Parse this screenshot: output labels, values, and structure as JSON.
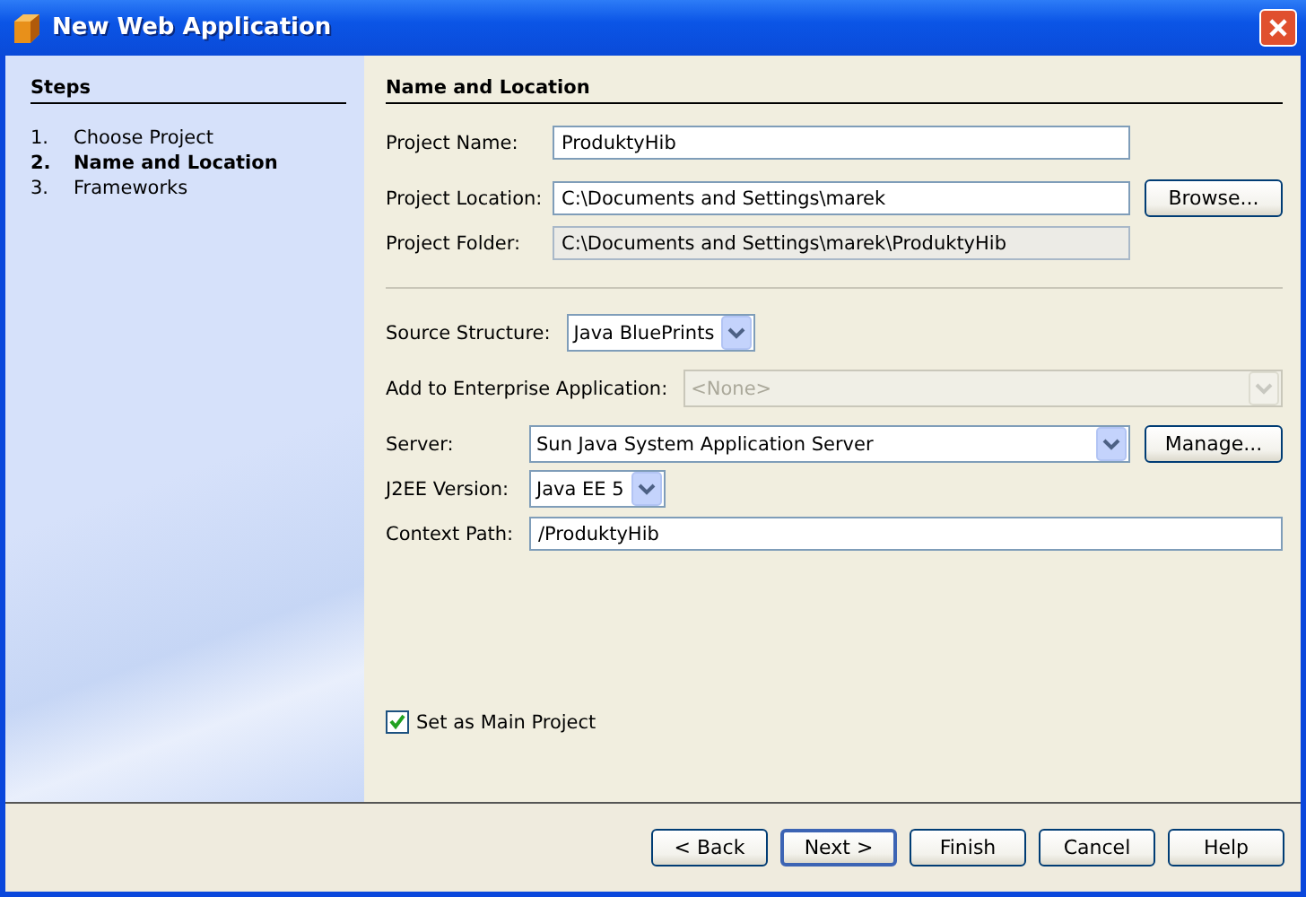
{
  "window": {
    "title": "New Web Application"
  },
  "steps": {
    "title": "Steps",
    "items": [
      {
        "number": "1.",
        "label": "Choose Project",
        "selected": false
      },
      {
        "number": "2.",
        "label": "Name and Location",
        "selected": true
      },
      {
        "number": "3.",
        "label": "Frameworks",
        "selected": false
      }
    ]
  },
  "panel": {
    "title": "Name and Location",
    "location_fields": [
      {
        "kind": "text",
        "label": "Project Name:",
        "value": "ProduktyHib"
      },
      {
        "kind": "text",
        "label": "Project Location:",
        "value": "C:\\Documents and Settings\\marek",
        "button": "Browse..."
      },
      {
        "kind": "readonly",
        "label": "Project Folder:",
        "value": "C:\\Documents and Settings\\marek\\ProduktyHib"
      }
    ],
    "settings_fields": [
      {
        "kind": "dropdown",
        "label": "Source Structure:",
        "value": "Java BluePrints",
        "disabled": false
      },
      {
        "kind": "combo",
        "label": "Add to Enterprise Application:",
        "value": "<None>",
        "disabled": true
      },
      {
        "kind": "combo",
        "label": "Server:",
        "value": "Sun Java System Application Server",
        "disabled": false,
        "button": "Manage..."
      },
      {
        "kind": "dropdown",
        "label": "J2EE Version:",
        "value": "Java EE 5",
        "disabled": false
      },
      {
        "kind": "text",
        "label": "Context Path:",
        "value": "/ProduktyHib"
      }
    ],
    "main_project": {
      "label": "Set as Main Project",
      "checked": true
    }
  },
  "buttons": [
    {
      "label": "< Back",
      "default": false
    },
    {
      "label": "Next >",
      "default": true
    },
    {
      "label": "Finish",
      "default": false
    },
    {
      "label": "Cancel",
      "default": false
    },
    {
      "label": "Help",
      "default": false
    }
  ]
}
